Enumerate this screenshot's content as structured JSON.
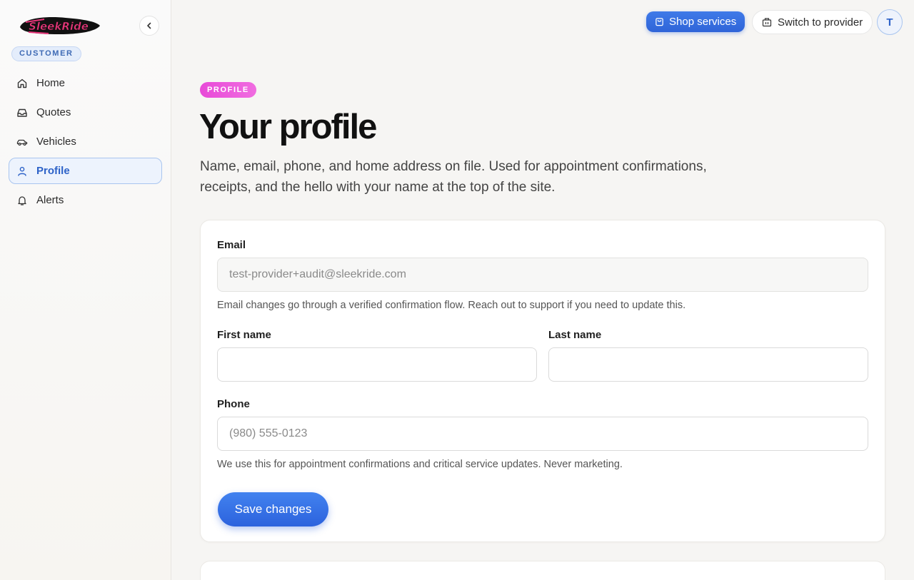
{
  "brand": {
    "logo_text": "SleekRide"
  },
  "sidebar": {
    "role_badge": "CUSTOMER",
    "items": [
      {
        "label": "Home",
        "icon": "home-icon"
      },
      {
        "label": "Quotes",
        "icon": "inbox-icon"
      },
      {
        "label": "Vehicles",
        "icon": "car-icon"
      },
      {
        "label": "Profile",
        "icon": "user-icon",
        "active": true
      },
      {
        "label": "Alerts",
        "icon": "bell-icon"
      }
    ]
  },
  "topbar": {
    "shop_label": "Shop services",
    "switch_label": "Switch to provider",
    "avatar_initial": "T"
  },
  "page": {
    "eyebrow": "PROFILE",
    "title": "Your profile",
    "description": "Name, email, phone, and home address on file. Used for appointment confirmations, receipts, and the hello with your name at the top of the site."
  },
  "form": {
    "email_label": "Email",
    "email_value": "test-provider+audit@sleekride.com",
    "email_hint": "Email changes go through a verified confirmation flow. Reach out to support if you need to update this.",
    "first_name_label": "First name",
    "first_name_value": "",
    "last_name_label": "Last name",
    "last_name_value": "",
    "phone_label": "Phone",
    "phone_placeholder": "(980) 555-0123",
    "phone_hint": "We use this for appointment confirmations and critical service updates. Never marketing.",
    "save_label": "Save changes"
  },
  "colors": {
    "accent": "#2f64d8",
    "eyebrow": "#e84ad8",
    "logo_pink": "#e8357a"
  }
}
